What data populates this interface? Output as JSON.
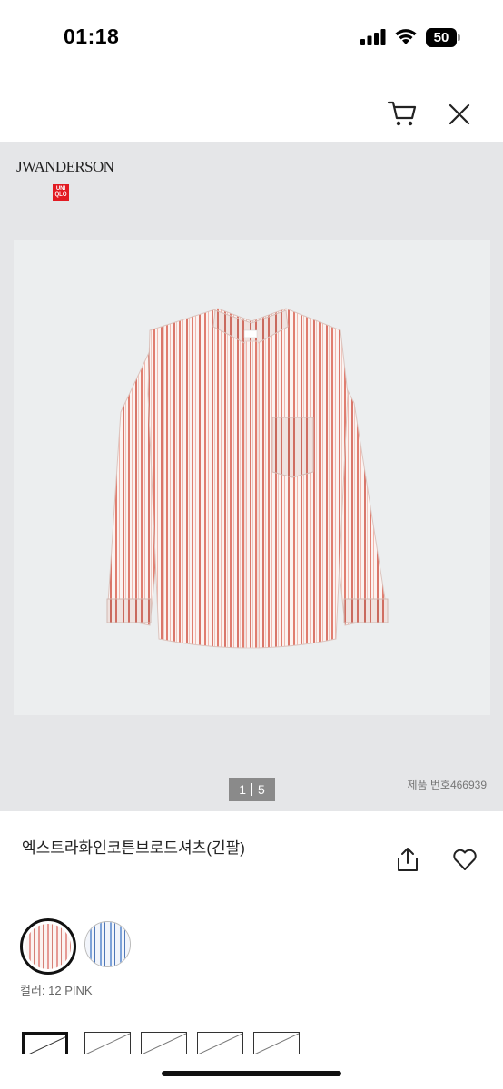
{
  "status_bar": {
    "time": "01:18",
    "battery": "50"
  },
  "header": {
    "cart_icon": "cart-icon",
    "close_icon": "close-icon"
  },
  "gallery": {
    "brand_text": "JWANDERSON",
    "brand_logo_lines": [
      "UNI",
      "QLO"
    ],
    "pager": {
      "current": "1",
      "total": "5"
    },
    "product_number": "제품 번호466939"
  },
  "product": {
    "title": "엑스트라화인코튼브로드셔츠(긴팔)",
    "color_label": "컬러: 12 PINK",
    "colors": [
      "#e69a95",
      "#7fa3d8"
    ]
  },
  "icons": {
    "share": "share-icon",
    "wishlist": "heart-icon"
  }
}
